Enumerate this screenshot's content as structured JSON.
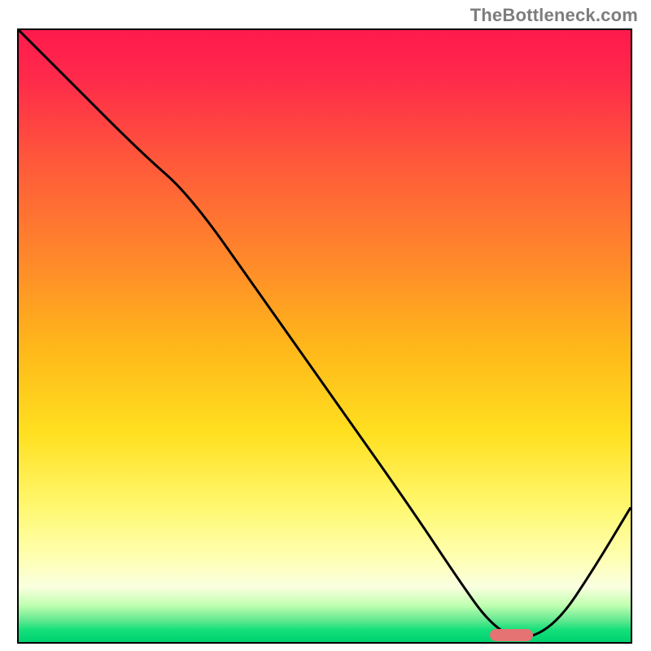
{
  "attribution": "TheBottleneck.com",
  "colors": {
    "frame": "#000000",
    "curve": "#000000",
    "marker": "#e57373",
    "gradient_top": "#ff1a4d",
    "gradient_bottom": "#00d070"
  },
  "chart_data": {
    "type": "line",
    "title": "",
    "xlabel": "",
    "ylabel": "",
    "xlim": [
      0,
      100
    ],
    "ylim": [
      0,
      100
    ],
    "legend": false,
    "grid": false,
    "background": "red-yellow-green vertical gradient",
    "series": [
      {
        "name": "bottleneck-curve",
        "x": [
          0,
          8,
          20,
          28,
          40,
          52,
          64,
          72,
          77,
          82,
          88,
          94,
          100
        ],
        "y": [
          100,
          92,
          80,
          73,
          56,
          39,
          22,
          10,
          3,
          0,
          3,
          12,
          22
        ]
      }
    ],
    "annotations": [
      {
        "name": "optimal-zone-marker",
        "type": "rounded-bar",
        "x_start": 77,
        "x_end": 84,
        "y": 0,
        "height_pct": 2
      }
    ],
    "notes": "X axis unlabeled (implied: hardware pairing / configuration). Y axis unlabeled (implied: bottleneck percentage). Minimum ≈ x 80. Values estimated from plotted curve; no numeric tick labels are shown in the image."
  }
}
